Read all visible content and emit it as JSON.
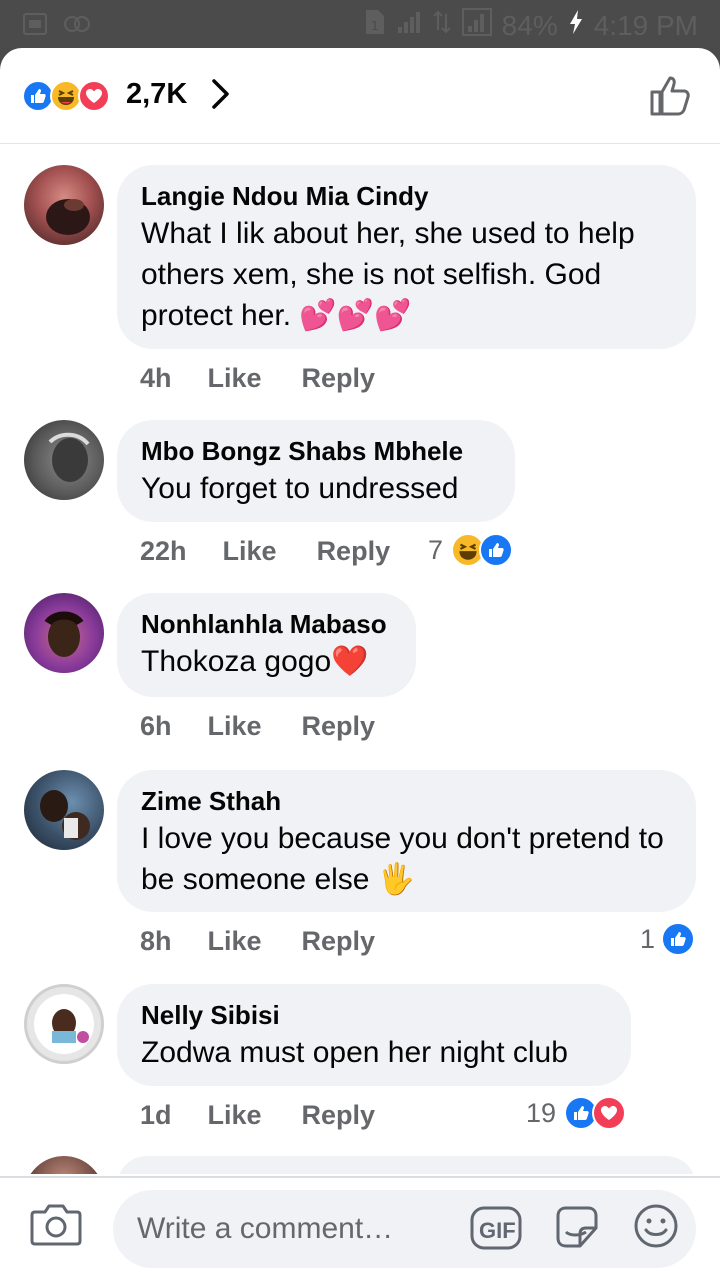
{
  "status_bar": {
    "battery": "84%",
    "time": "4:19 PM"
  },
  "reactions_header": {
    "count": "2,7K",
    "icons": [
      "like-reaction",
      "haha-reaction",
      "love-reaction"
    ]
  },
  "comments": [
    {
      "author": "Langie Ndou Mia Cindy",
      "text": "What I lik about her, she used to help others xem, she is not selfish.  God protect her. 💕💕💕",
      "time": "4h",
      "like_label": "Like",
      "reply_label": "Reply",
      "reaction_count": ""
    },
    {
      "author": "Mbo Bongz Shabs Mbhele",
      "text": "You forget to undressed",
      "time": "22h",
      "like_label": "Like",
      "reply_label": "Reply",
      "reaction_count": "7"
    },
    {
      "author": "Nonhlanhla Mabaso",
      "text": "Thokoza gogo❤️",
      "time": "6h",
      "like_label": "Like",
      "reply_label": "Reply",
      "reaction_count": ""
    },
    {
      "author": "Zime Sthah",
      "text": "I love you because you don't pretend to be someone else 🖐",
      "time": "8h",
      "like_label": "Like",
      "reply_label": "Reply",
      "reaction_count": "1"
    },
    {
      "author": "Nelly Sibisi",
      "text": "Zodwa must open her night club",
      "time": "1d",
      "like_label": "Like",
      "reply_label": "Reply",
      "reaction_count": "19"
    }
  ],
  "composer": {
    "placeholder": "Write a comment…",
    "gif_label": "GIF"
  },
  "colors": {
    "like_blue": "#1877f2",
    "love_red": "#f33e58",
    "haha_yellow": "#f7b928",
    "bubble_bg": "#f0f2f5",
    "meta_gray": "#65676b"
  }
}
